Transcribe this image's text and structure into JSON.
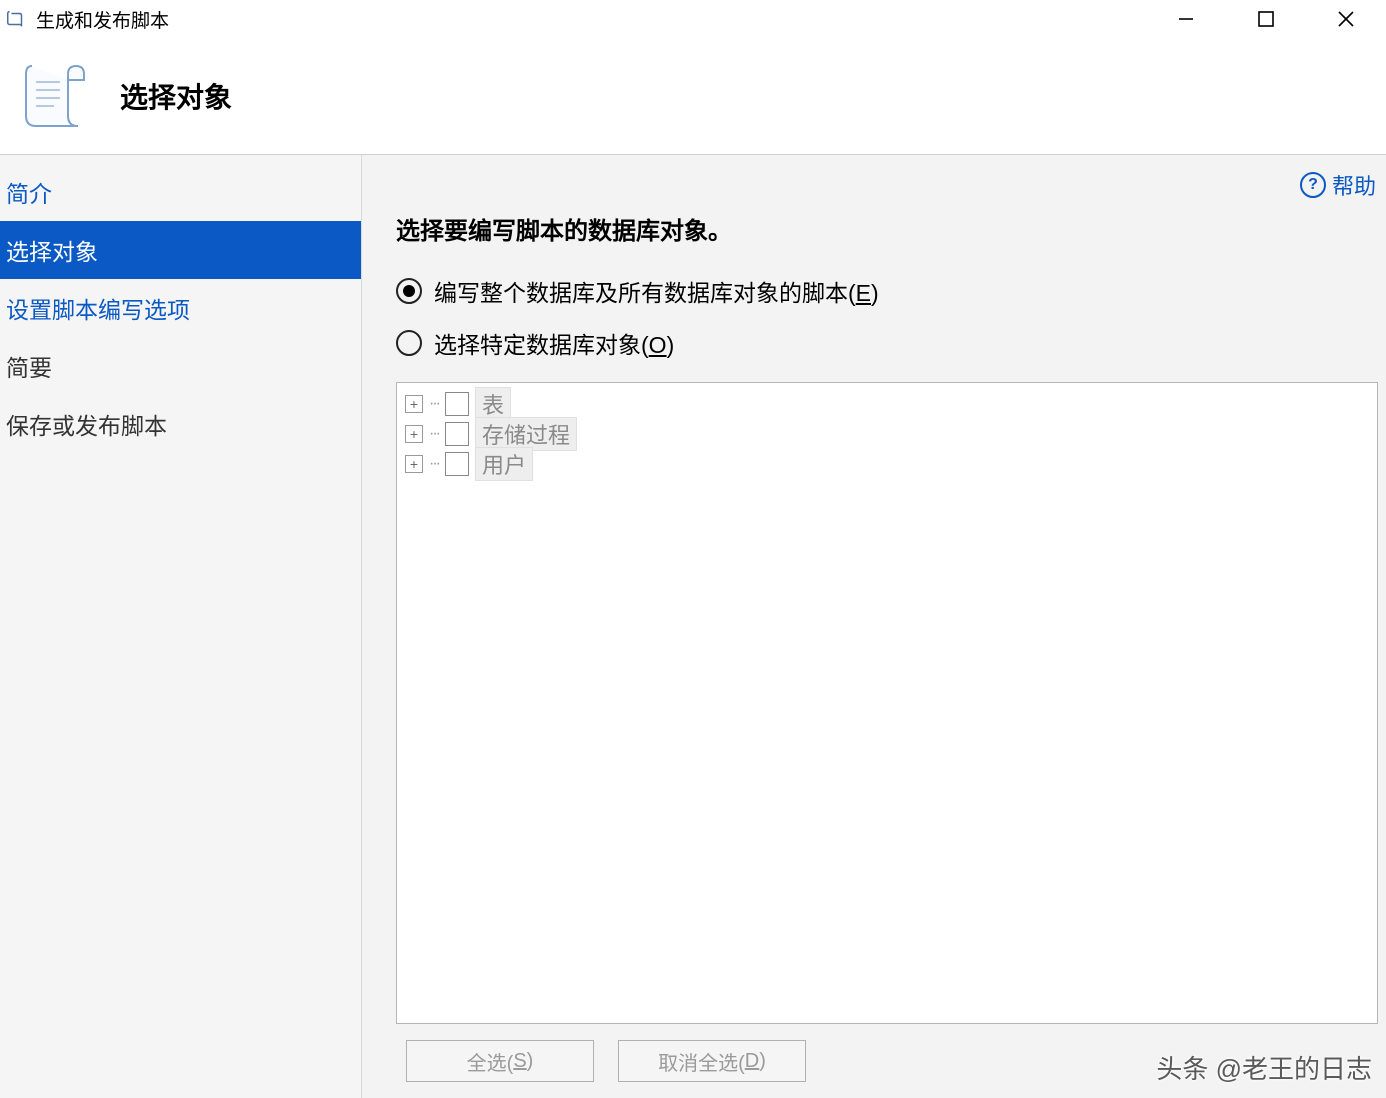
{
  "titlebar": {
    "title": "生成和发布脚本"
  },
  "header": {
    "page_title": "选择对象"
  },
  "sidebar": {
    "items": [
      {
        "label": "简介",
        "cls": "link"
      },
      {
        "label": "选择对象",
        "cls": "active"
      },
      {
        "label": "设置脚本编写选项",
        "cls": "link"
      },
      {
        "label": "简要",
        "cls": ""
      },
      {
        "label": "保存或发布脚本",
        "cls": ""
      }
    ]
  },
  "content": {
    "help_label": "帮助",
    "instruction": "选择要编写脚本的数据库对象。",
    "radio_all_pre": "编写整个数据库及所有数据库对象的脚本(",
    "radio_all_key": "E",
    "radio_all_post": ")",
    "radio_sel_pre": "选择特定数据库对象(",
    "radio_sel_key": "O",
    "radio_sel_post": ")",
    "tree": [
      {
        "label": "表"
      },
      {
        "label": "存储过程"
      },
      {
        "label": "用户"
      }
    ],
    "btn_select_all_pre": "全选(",
    "btn_select_all_key": "S",
    "btn_select_all_post": ")",
    "btn_deselect_all_pre": "取消全选(",
    "btn_deselect_all_key": "D",
    "btn_deselect_all_post": ")"
  },
  "watermark": "头条 @老王的日志"
}
